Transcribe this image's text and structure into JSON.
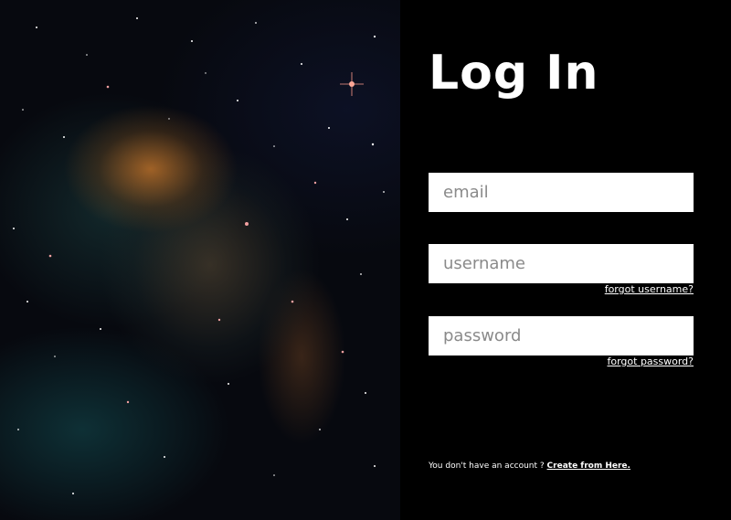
{
  "background": {
    "image": "nebula-space-image",
    "panel_color": "#000000"
  },
  "title": "Log In",
  "fields": {
    "email": {
      "placeholder": "email",
      "value": ""
    },
    "username": {
      "placeholder": "username",
      "value": ""
    },
    "password": {
      "placeholder": "password",
      "value": ""
    }
  },
  "links": {
    "forgot_username": "forgot username?",
    "forgot_password": "forgot password?"
  },
  "signup": {
    "prompt": "You don't have an account ? ",
    "link": "Create from Here."
  }
}
